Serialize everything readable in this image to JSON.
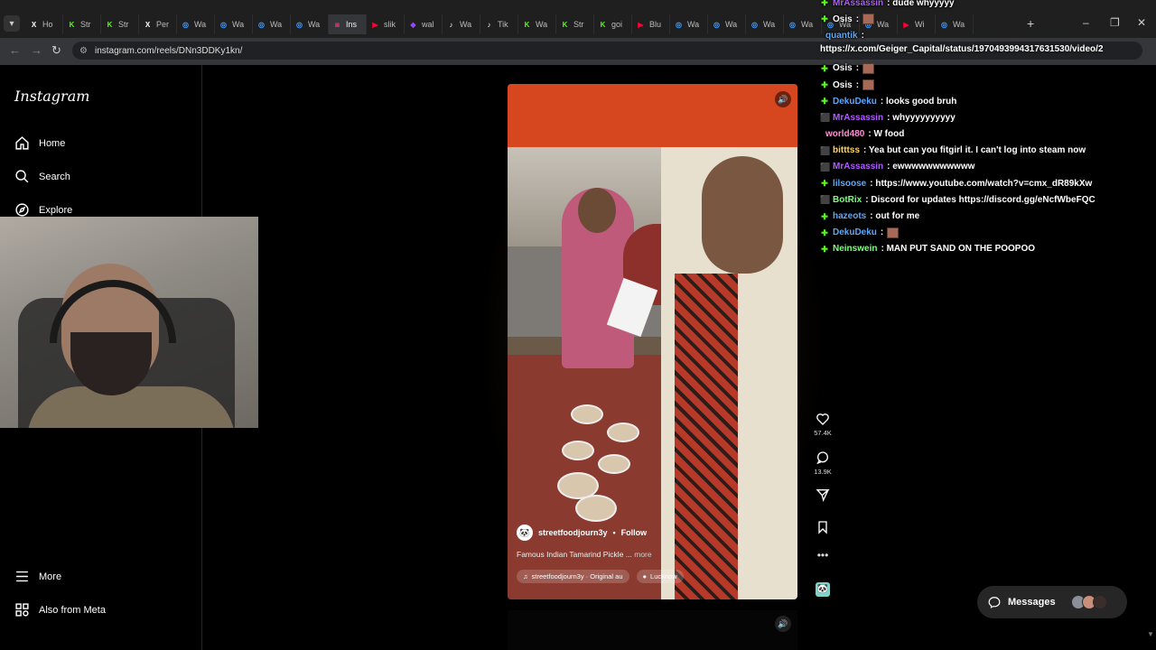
{
  "browser": {
    "tabs": [
      {
        "label": "Ho",
        "icon": "x-icon",
        "color": "#ffffff"
      },
      {
        "label": "Str",
        "icon": "kick-icon",
        "color": "#53fc18"
      },
      {
        "label": "Str",
        "icon": "kick-icon",
        "color": "#53fc18"
      },
      {
        "label": "Per",
        "icon": "x-icon",
        "color": "#ffffff"
      },
      {
        "label": "Wa",
        "icon": "globe-icon",
        "color": "#4aa3ff"
      },
      {
        "label": "Wa",
        "icon": "globe-icon",
        "color": "#4aa3ff"
      },
      {
        "label": "Wa",
        "icon": "globe-icon",
        "color": "#4aa3ff"
      },
      {
        "label": "Wa",
        "icon": "globe-icon",
        "color": "#4aa3ff"
      },
      {
        "label": "Ins",
        "icon": "instagram-icon",
        "color": "#e1306c"
      },
      {
        "label": "slik",
        "icon": "youtube-icon",
        "color": "#ff0033"
      },
      {
        "label": "wal",
        "icon": "twitch-icon",
        "color": "#9146ff"
      },
      {
        "label": "Wa",
        "icon": "tiktok-icon",
        "color": "#ffffff"
      },
      {
        "label": "Tik",
        "icon": "tiktok-icon",
        "color": "#ffffff"
      },
      {
        "label": "Wa",
        "icon": "kick-icon",
        "color": "#53fc18"
      },
      {
        "label": "Str",
        "icon": "kick-icon",
        "color": "#53fc18"
      },
      {
        "label": "goi",
        "icon": "kick-icon",
        "color": "#53fc18"
      },
      {
        "label": "Blu",
        "icon": "youtube-icon",
        "color": "#ff0033"
      },
      {
        "label": "Wa",
        "icon": "globe-icon",
        "color": "#4aa3ff"
      },
      {
        "label": "Wa",
        "icon": "globe-icon",
        "color": "#4aa3ff"
      },
      {
        "label": "Wa",
        "icon": "globe-icon",
        "color": "#4aa3ff"
      },
      {
        "label": "Wa",
        "icon": "globe-icon",
        "color": "#4aa3ff"
      },
      {
        "label": "Wa",
        "icon": "globe-icon",
        "color": "#4aa3ff"
      },
      {
        "label": "Wa",
        "icon": "globe-icon",
        "color": "#4aa3ff"
      },
      {
        "label": "Wi",
        "icon": "youtube-icon",
        "color": "#ff0033"
      },
      {
        "label": "Wa",
        "icon": "globe-icon",
        "color": "#4aa3ff"
      }
    ],
    "url": "instagram.com/reels/DNn3DDKy1kn/",
    "new_tab": "+"
  },
  "sidebar": {
    "logo": "Instagram",
    "items": [
      {
        "label": "Home",
        "icon": "home-icon"
      },
      {
        "label": "Search",
        "icon": "search-icon"
      },
      {
        "label": "Explore",
        "icon": "explore-icon"
      }
    ],
    "bottom": [
      {
        "label": "More",
        "icon": "menu-icon"
      },
      {
        "label": "Also from Meta",
        "icon": "meta-icon"
      }
    ]
  },
  "reel": {
    "username": "streetfoodjourn3y",
    "separator": "•",
    "follow": "Follow",
    "caption": "Famous Indian Tamarind Pickle ...",
    "more": "more",
    "audio": "streetfoodjourn3y · Original au",
    "location": "Lucknow",
    "likes": "57.4K",
    "comments": "13.9K"
  },
  "chat": {
    "url_line": "https://x.com/Geiger_Capital/status/1970493994317631530/video/2",
    "messages": [
      {
        "user": "MrAssassin",
        "color": "#b05cff",
        "text": ": dude whyyyyy",
        "badge": "kick"
      },
      {
        "user": "Osis",
        "color": "#ffffff",
        "text": ":",
        "badge": "kick",
        "emote": true
      },
      {
        "user": "quantik",
        "color": "#59a8ff",
        "text": ":",
        "badge": "none"
      },
      {
        "user": "Osis",
        "color": "#ffffff",
        "text": ":",
        "badge": "kick",
        "emote": true
      },
      {
        "user": "Osis",
        "color": "#ffffff",
        "text": ":",
        "badge": "kick",
        "emote": true
      },
      {
        "user": "DekuDeku",
        "color": "#59a8ff",
        "text": ": looks good bruh",
        "badge": "kick"
      },
      {
        "user": "MrAssassin",
        "color": "#b05cff",
        "text": ": whyyyyyyyyyy",
        "badge": "multi"
      },
      {
        "user": "world480",
        "color": "#ff8fd5",
        "text": ": W food",
        "badge": "none"
      },
      {
        "user": "bitttss",
        "color": "#ffd36b",
        "text": ": Yea but can you fitgirl it. I can't log into steam now",
        "badge": "multi"
      },
      {
        "user": "MrAssassin",
        "color": "#b05cff",
        "text": ": ewwwwwwwwwww",
        "badge": "multi"
      },
      {
        "user": "lilsoose",
        "color": "#59a8ff",
        "text": ": https://www.youtube.com/watch?v=cmx_dR89kXw",
        "badge": "kick"
      },
      {
        "user": "BotRix",
        "color": "#7cff7c",
        "text": ": Discord for updates https://discord.gg/eNcfWbeFQC",
        "badge": "multi"
      },
      {
        "user": "hazeots",
        "color": "#59a8ff",
        "text": ": out for me",
        "badge": "kick"
      },
      {
        "user": "DekuDeku",
        "color": "#59a8ff",
        "text": ":",
        "badge": "kick",
        "emote": true
      },
      {
        "user": "Neinswein",
        "color": "#7cff7c",
        "text": ": MAN PUT SAND ON THE POOPOO",
        "badge": "kick"
      }
    ]
  },
  "messages_button": {
    "label": "Messages"
  }
}
